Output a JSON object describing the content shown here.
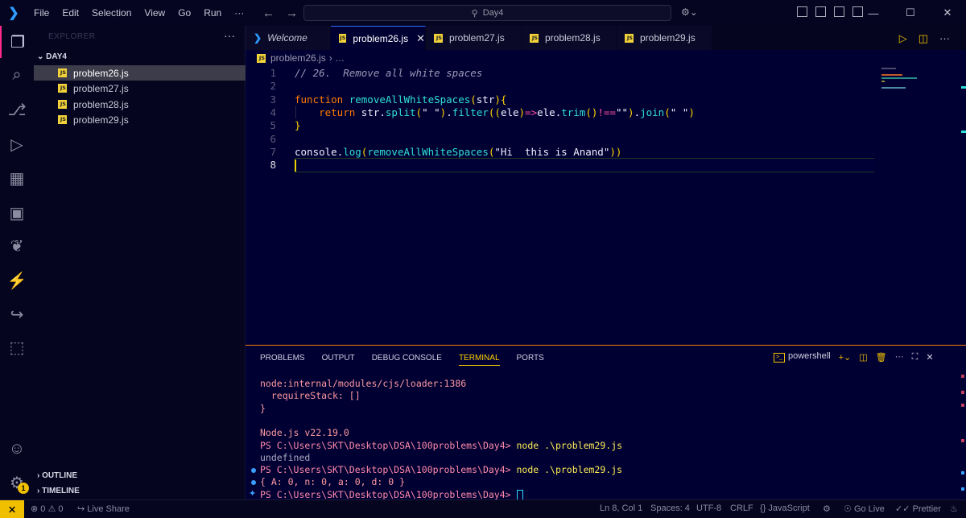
{
  "titlebar": {
    "menu": [
      "File",
      "Edit",
      "Selection",
      "View",
      "Go",
      "Run",
      "···"
    ],
    "search": "Day4",
    "window_controls": [
      "—",
      "☐",
      "✕"
    ]
  },
  "activity": [
    {
      "icon": "explorer-icon",
      "glyph": "❐"
    },
    {
      "icon": "search-icon",
      "glyph": "⌕"
    },
    {
      "icon": "source-control-icon",
      "glyph": "⎇"
    },
    {
      "icon": "run-debug-icon",
      "glyph": "▷"
    },
    {
      "icon": "extensions-icon",
      "glyph": "▦"
    },
    {
      "icon": "remote-explorer-icon",
      "glyph": "▣"
    },
    {
      "icon": "mongodb-leaf-icon",
      "glyph": "❦"
    },
    {
      "icon": "thunder-client-icon",
      "glyph": "⚡"
    },
    {
      "icon": "live-share-icon",
      "glyph": "↪"
    },
    {
      "icon": "package-icon",
      "glyph": "⬚"
    }
  ],
  "activity_bottom": [
    {
      "icon": "account-icon",
      "glyph": "☺"
    },
    {
      "icon": "settings-gear-icon",
      "glyph": "⚙"
    }
  ],
  "activity_badge": "1",
  "sidebar": {
    "header": "EXPLORER",
    "folder": "DAY4",
    "files": [
      "problem26.js",
      "problem27.js",
      "problem28.js",
      "problem29.js"
    ],
    "selected": "problem26.js",
    "outline": "OUTLINE",
    "timeline": "TIMELINE"
  },
  "tabs": [
    {
      "label": "Welcome",
      "type": "welcome"
    },
    {
      "label": "problem26.js",
      "type": "js",
      "active": true
    },
    {
      "label": "problem27.js",
      "type": "js"
    },
    {
      "label": "problem28.js",
      "type": "js"
    },
    {
      "label": "problem29.js",
      "type": "js"
    }
  ],
  "breadcrumb": {
    "file": "problem26.js",
    "rest": "› …"
  },
  "editor": {
    "line_numbers": [
      "1",
      "2",
      "3",
      "4",
      "5",
      "6",
      "7",
      "8"
    ],
    "current_line": "8",
    "lines": [
      [
        {
          "t": "// 26.  Remove all white spaces",
          "c": "c-com"
        }
      ],
      [],
      [
        {
          "t": "function ",
          "c": "c-kw"
        },
        {
          "t": "removeAllWhiteSpaces",
          "c": "c-fn"
        },
        {
          "t": "(",
          "c": "c-pn"
        },
        {
          "t": "str",
          "c": "c-id"
        },
        {
          "t": "){",
          "c": "c-pn"
        }
      ],
      [
        {
          "t": "    return ",
          "c": "c-kw"
        },
        {
          "t": "str",
          "c": "c-id"
        },
        {
          "t": ".",
          "c": "c-id"
        },
        {
          "t": "split",
          "c": "c-fn"
        },
        {
          "t": "(",
          "c": "c-pn"
        },
        {
          "t": "\" \"",
          "c": "c-str"
        },
        {
          "t": ")",
          "c": "c-pn"
        },
        {
          "t": ".",
          "c": "c-id"
        },
        {
          "t": "filter",
          "c": "c-fn"
        },
        {
          "t": "((",
          "c": "c-pn"
        },
        {
          "t": "ele",
          "c": "c-id"
        },
        {
          "t": ")",
          "c": "c-pn"
        },
        {
          "t": "=>",
          "c": "c-op"
        },
        {
          "t": "ele",
          "c": "c-id"
        },
        {
          "t": ".",
          "c": "c-id"
        },
        {
          "t": "trim",
          "c": "c-fn"
        },
        {
          "t": "()",
          "c": "c-pn"
        },
        {
          "t": "!==",
          "c": "c-op"
        },
        {
          "t": "\"\"",
          "c": "c-str"
        },
        {
          "t": ")",
          "c": "c-pn"
        },
        {
          "t": ".",
          "c": "c-id"
        },
        {
          "t": "join",
          "c": "c-fn"
        },
        {
          "t": "(",
          "c": "c-pn"
        },
        {
          "t": "\" \"",
          "c": "c-str"
        },
        {
          "t": ")",
          "c": "c-pn"
        }
      ],
      [
        {
          "t": "}",
          "c": "c-pn"
        }
      ],
      [],
      [
        {
          "t": "console",
          "c": "c-id"
        },
        {
          "t": ".",
          "c": "c-id"
        },
        {
          "t": "log",
          "c": "c-fn"
        },
        {
          "t": "(",
          "c": "c-pn"
        },
        {
          "t": "removeAllWhiteSpaces",
          "c": "c-fn"
        },
        {
          "t": "(",
          "c": "c-pn"
        },
        {
          "t": "\"Hi  this is Anand\"",
          "c": "c-str"
        },
        {
          "t": "))",
          "c": "c-pn"
        }
      ],
      []
    ]
  },
  "panel": {
    "tabs": [
      "PROBLEMS",
      "OUTPUT",
      "DEBUG CONSOLE",
      "TERMINAL",
      "PORTS"
    ],
    "active_tab": "TERMINAL",
    "shell": "powershell",
    "terminal": [
      {
        "text": "node:internal/modules/cjs/loader:1386",
        "kind": "red"
      },
      {
        "text": "  requireStack: []",
        "kind": "red"
      },
      {
        "text": "}",
        "kind": "red"
      },
      {
        "text": "",
        "kind": "dim"
      },
      {
        "text": "Node.js v22.19.0",
        "kind": "red"
      },
      {
        "prompt": "PS C:\\Users\\SKT\\Desktop\\DSA\\100problems\\Day4> ",
        "cmd": "node .\\problem29.js",
        "kind": "prompt"
      },
      {
        "text": "undefined",
        "kind": "dim"
      },
      {
        "prompt": "PS C:\\Users\\SKT\\Desktop\\DSA\\100problems\\Day4> ",
        "cmd": "node .\\problem29.js",
        "kind": "prompt",
        "dot": true
      },
      {
        "text": "{ A: 0, n: 0, a: 0, d: 0 }",
        "kind": "red",
        "dot": true
      },
      {
        "prompt": "PS C:\\Users\\SKT\\Desktop\\DSA\\100problems\\Day4> ",
        "cmd": "",
        "kind": "prompt",
        "sparkle": true,
        "cursor": true
      }
    ]
  },
  "status": {
    "remote": "⨯",
    "problems": "⊗ 0 ⚠ 0",
    "live_share": "Live Share",
    "position": "Ln 8, Col 1",
    "spaces": "Spaces: 4",
    "encoding": "UTF-8",
    "eol": "CRLF",
    "language": "JavaScript",
    "go_live": "Go Live",
    "prettier": "Prettier"
  },
  "colors": {
    "accent": "#f0c000",
    "active_border": "#ff2a8a",
    "panel_border": "#ff7a00",
    "editor_bg": "#000033"
  }
}
